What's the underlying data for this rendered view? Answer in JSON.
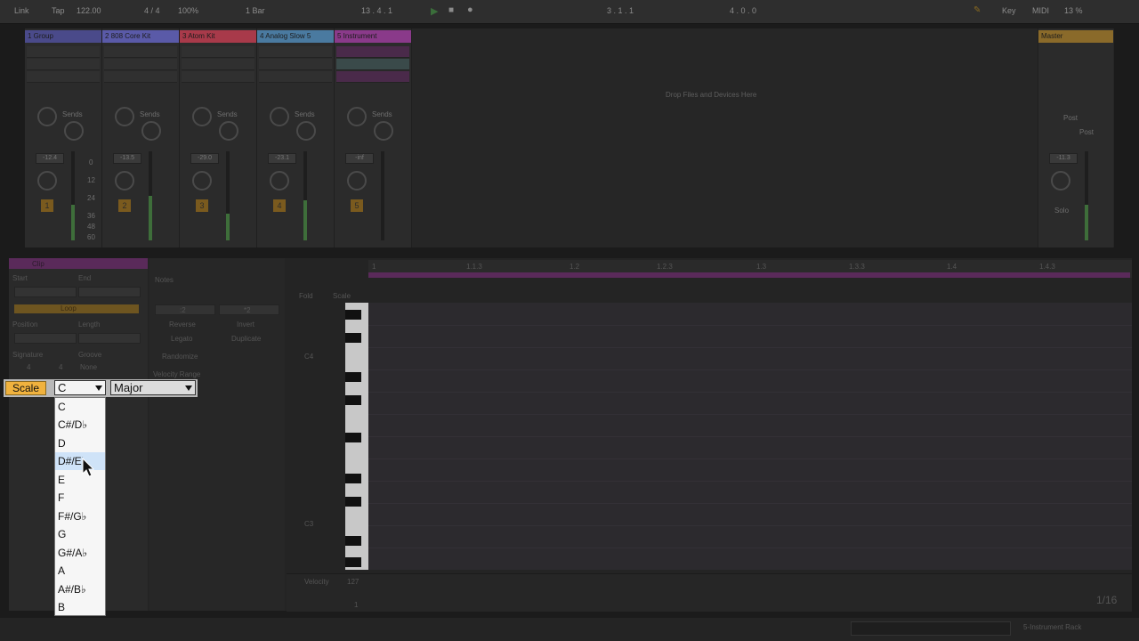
{
  "transport": {
    "link": "Link",
    "tap": "Tap",
    "tempo": "122.00",
    "signature": "4 / 4",
    "zoom": "100%",
    "quantize": "1 Bar",
    "position": "13 .   4 .   1",
    "loop_start": "3 .   1 .   1",
    "loop_length": "4 .   0 .   0",
    "key": "Key",
    "midi": "MIDI",
    "cpu": "13 %"
  },
  "tracks": [
    {
      "name": "1 Group",
      "color": "#4a4a8a",
      "volume": "-12.4",
      "number": "1"
    },
    {
      "name": "2 808 Core Kit",
      "color": "#5a5aa8",
      "volume": "-13.5",
      "number": "2"
    },
    {
      "name": "3 Atom Kit",
      "color": "#a83a4a",
      "volume": "-29.0",
      "number": "3"
    },
    {
      "name": "4 Analog Slow 5",
      "color": "#4a7aa0",
      "volume": "-23.1",
      "number": "4"
    },
    {
      "name": "5 Instrument",
      "color": "#8a3a8a",
      "volume": "-inf",
      "number": "5"
    }
  ],
  "sends_label": "Sends",
  "meter_scale": [
    "0",
    "12",
    "24",
    "36",
    "48",
    "60"
  ],
  "drop_text": "Drop Files and Devices Here",
  "master": {
    "name": "Master",
    "volume": "-11.3",
    "post1": "Post",
    "post2": "Post",
    "solo": "Solo"
  },
  "clip_panel": {
    "title": "Clip",
    "start": "Start",
    "end": "End",
    "loop": "Loop",
    "position": "Position",
    "length": "Length",
    "signature": "Signature",
    "groove": "Groove",
    "sig_num": "4",
    "sig_den": "4",
    "groove_val": "None"
  },
  "notes_panel": {
    "title": "Notes",
    "half": ":2",
    "double": "*2",
    "reverse": "Reverse",
    "invert": "Invert",
    "legato": "Legato",
    "duplicate": "Duplicate",
    "randomize": "Randomize",
    "velocity_range": "Velocity Range",
    "fold": "Fold",
    "scale": "Scale"
  },
  "ruler": [
    "1",
    "1.1.3",
    "1.2",
    "1.2.3",
    "1.3",
    "1.3.3",
    "1.4",
    "1.4.3"
  ],
  "piano_labels": {
    "c4": "C4",
    "c3": "C3"
  },
  "velocity": {
    "label": "Velocity",
    "max": "127",
    "min": "1"
  },
  "grid_fraction": "1/16",
  "status_right": "5-Instrument Rack",
  "scale_controls": {
    "scale_button": "Scale",
    "root_selected": "C",
    "mode_selected": "Major",
    "root_options": [
      "C",
      "C#/D♭",
      "D",
      "D#/E♭",
      "E",
      "F",
      "F#/G♭",
      "G",
      "G#/A♭",
      "A",
      "A#/B♭",
      "B"
    ],
    "highlighted_index": 3
  },
  "colors": {
    "scale_button": "#f0b23e",
    "highlight": "#cfe3f8",
    "loop_bar": "#5a2a5a"
  }
}
